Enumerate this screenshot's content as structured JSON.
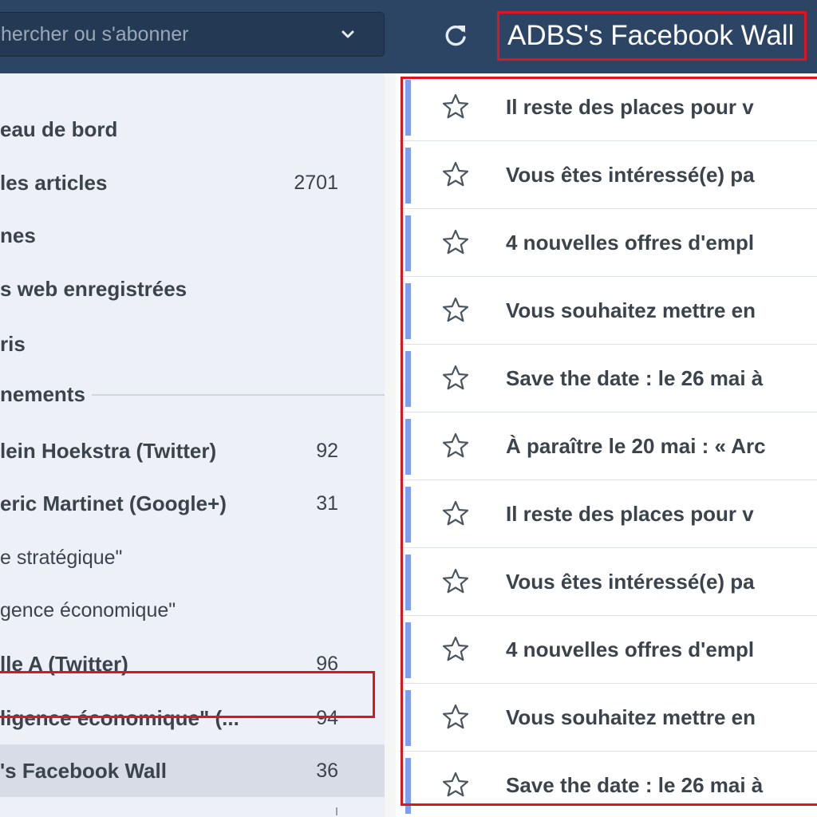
{
  "header": {
    "search_placeholder": "hercher ou s'abonner",
    "feed_title": "ADBS's Facebook Wall"
  },
  "sidebar": {
    "items": [
      {
        "label": "eau de bord",
        "count": ""
      },
      {
        "label": "les articles",
        "count": "2701"
      },
      {
        "label": "nes",
        "count": ""
      },
      {
        "label": "s web enregistrées",
        "count": ""
      },
      {
        "label": "ris",
        "count": ""
      }
    ],
    "section_label": "nements",
    "feeds": [
      {
        "label": "lein Hoekstra (Twitter)",
        "count": "92",
        "bold": true
      },
      {
        "label": "eric Martinet (Google+)",
        "count": "31",
        "bold": true
      },
      {
        "label": "e stratégique\"",
        "count": "",
        "bold": false
      },
      {
        "label": "gence économique\"",
        "count": "",
        "bold": false
      },
      {
        "label": "lle A (Twitter)",
        "count": "96",
        "bold": true
      },
      {
        "label": "ligence économique\" (...",
        "count": "94",
        "bold": true
      },
      {
        "label": "'s Facebook Wall",
        "count": "36",
        "bold": true
      }
    ]
  },
  "articles": [
    {
      "title": "Il reste des places pour v"
    },
    {
      "title": "Vous êtes intéressé(e) pa"
    },
    {
      "title": "4 nouvelles offres d'empl"
    },
    {
      "title": "Vous souhaitez mettre en"
    },
    {
      "title": "Save the date : le 26 mai à"
    },
    {
      "title": "À paraître le 20 mai : « Arc"
    },
    {
      "title": "Il reste des places pour v"
    },
    {
      "title": "Vous êtes intéressé(e) pa"
    },
    {
      "title": "4 nouvelles offres d'empl"
    },
    {
      "title": "Vous souhaitez mettre en"
    },
    {
      "title": "Save the date : le 26 mai à"
    }
  ],
  "icons": {
    "refresh": "refresh-icon",
    "chevron": "chevron-down-icon",
    "star": "star-outline-icon"
  },
  "colors": {
    "topbar": "#2c4564",
    "sidebar_bg": "#eef0f7",
    "selected_bg": "#d8dce6",
    "unread_bar": "#7d9ef1",
    "highlight_border": "#e0141e",
    "text": "#3b434d"
  }
}
